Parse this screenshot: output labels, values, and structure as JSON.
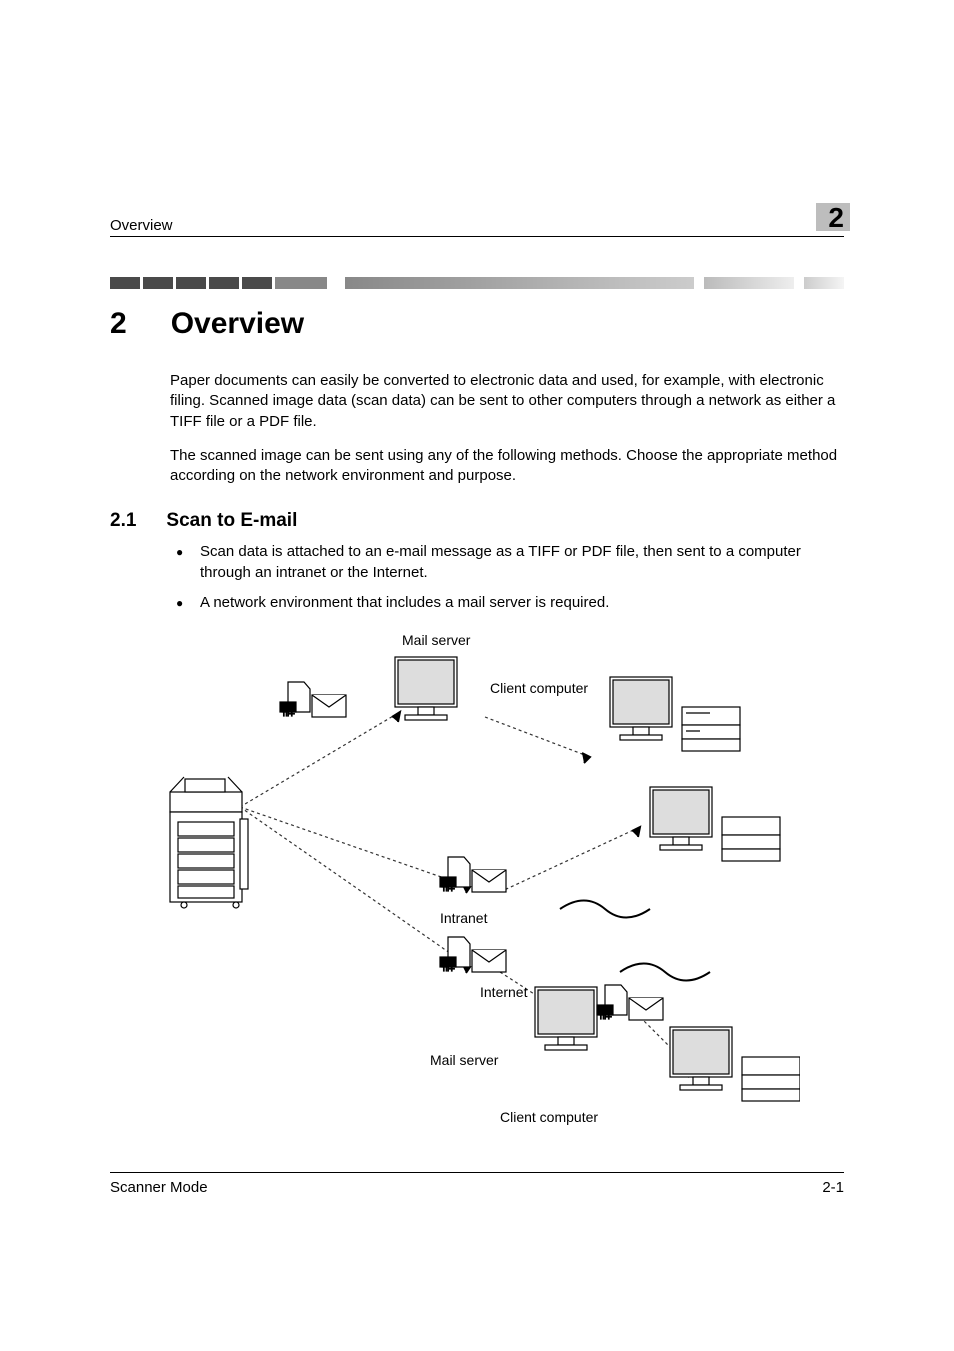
{
  "header": {
    "section_name": "Overview",
    "chapter_tab": "2"
  },
  "chapter": {
    "number": "2",
    "title": "Overview"
  },
  "intro": {
    "p1": "Paper documents can easily be converted to electronic data and used, for example, with electronic filing. Scanned image data (scan data) can be sent to other computers through a network as either a TIFF file or a PDF file.",
    "p2": "The scanned image can be sent using any of the following methods. Choose the appropriate method according on the network environment and purpose."
  },
  "section": {
    "number": "2.1",
    "title": "Scan to E-mail",
    "bullets": [
      "Scan data is attached to an e-mail message as a TIFF or PDF file, then sent to a computer through an intranet or the Internet.",
      "A network environment that includes a mail server is required."
    ]
  },
  "diagram": {
    "labels": {
      "mail_server_top": "Mail server",
      "client_computer_top": "Client computer",
      "intranet": "Intranet",
      "internet": "Internet",
      "mail_server_bottom": "Mail server",
      "client_computer_bottom": "Client computer",
      "file_tag_top": "PDF",
      "file_tag_bottom": "TIFF"
    }
  },
  "footer": {
    "left": "Scanner Mode",
    "right": "2-1"
  }
}
